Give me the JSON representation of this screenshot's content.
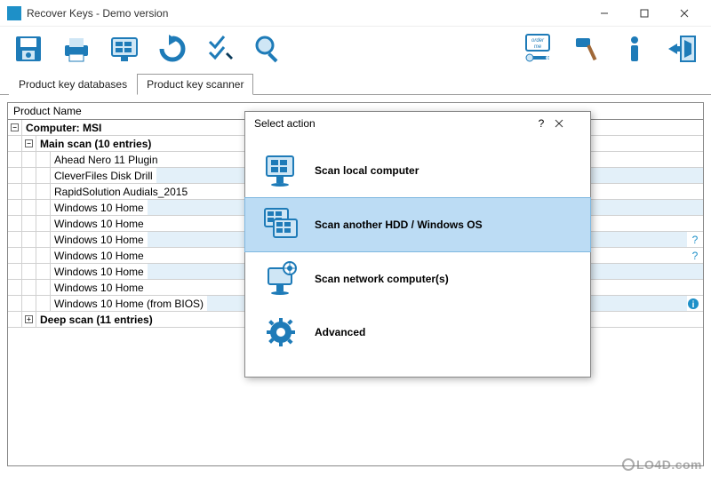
{
  "window": {
    "title": "Recover Keys - Demo version"
  },
  "toolbar": {
    "icons": [
      "save-icon",
      "print-icon",
      "windows-icon",
      "refresh-icon",
      "check-icon",
      "search-icon",
      "order-icon",
      "hammer-icon",
      "info-icon",
      "exit-icon"
    ]
  },
  "tabs": {
    "databases": "Product key databases",
    "scanner": "Product key scanner",
    "active": "scanner"
  },
  "grid": {
    "header": "Product Name",
    "computer": "Computer: MSI",
    "main_scan_label": "Main scan (10 entries)",
    "deep_scan_label": "Deep scan (11 entries)",
    "items": [
      {
        "name": "Ahead Nero 11 Plugin",
        "alt": false
      },
      {
        "name": "CleverFiles Disk Drill",
        "alt": true
      },
      {
        "name": "RapidSolution Audials_2015",
        "alt": false
      },
      {
        "name": "Windows 10 Home",
        "alt": true
      },
      {
        "name": "Windows 10 Home",
        "alt": false
      },
      {
        "name": "Windows 10 Home",
        "alt": true,
        "qmark": true
      },
      {
        "name": "Windows 10 Home",
        "alt": false,
        "qmark": true
      },
      {
        "name": "Windows 10 Home",
        "alt": true
      },
      {
        "name": "Windows 10 Home",
        "alt": false
      },
      {
        "name": "Windows 10 Home (from BIOS)",
        "alt": true,
        "info": true
      }
    ]
  },
  "dialog": {
    "title": "Select action",
    "actions": {
      "local": "Scan local computer",
      "another": "Scan another HDD / Windows OS",
      "network": "Scan network computer(s)",
      "advanced": "Advanced"
    },
    "selected": "another"
  },
  "watermark": "LO4D.com"
}
